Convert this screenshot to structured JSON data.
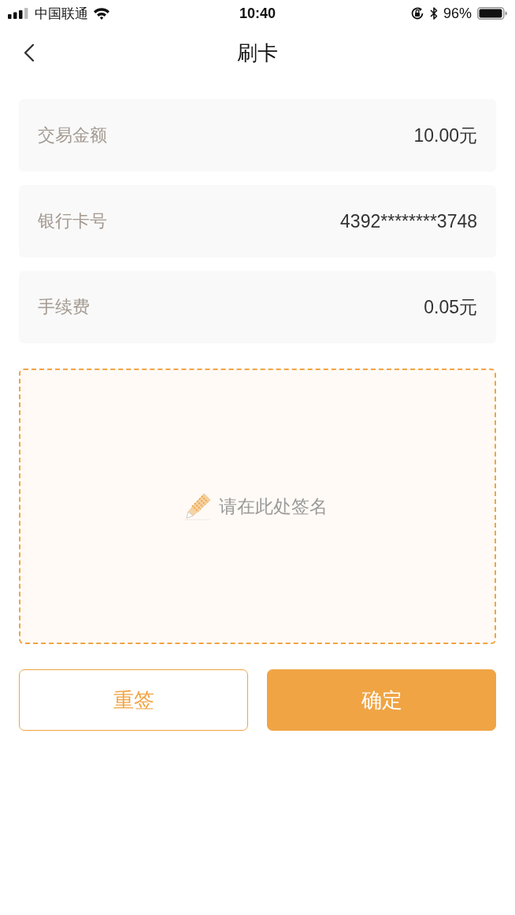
{
  "status_bar": {
    "carrier": "中国联通",
    "time": "10:40",
    "battery": "96%"
  },
  "nav": {
    "title": "刷卡"
  },
  "fields": [
    {
      "label": "交易金额",
      "value": "10.00元"
    },
    {
      "label": "银行卡号",
      "value": "4392********3748"
    },
    {
      "label": "手续费",
      "value": "0.05元"
    }
  ],
  "signature_pad": {
    "placeholder": "请在此处签名"
  },
  "buttons": [
    {
      "label": "重签",
      "kind": "outline"
    },
    {
      "label": "确定",
      "kind": "primary"
    }
  ]
}
